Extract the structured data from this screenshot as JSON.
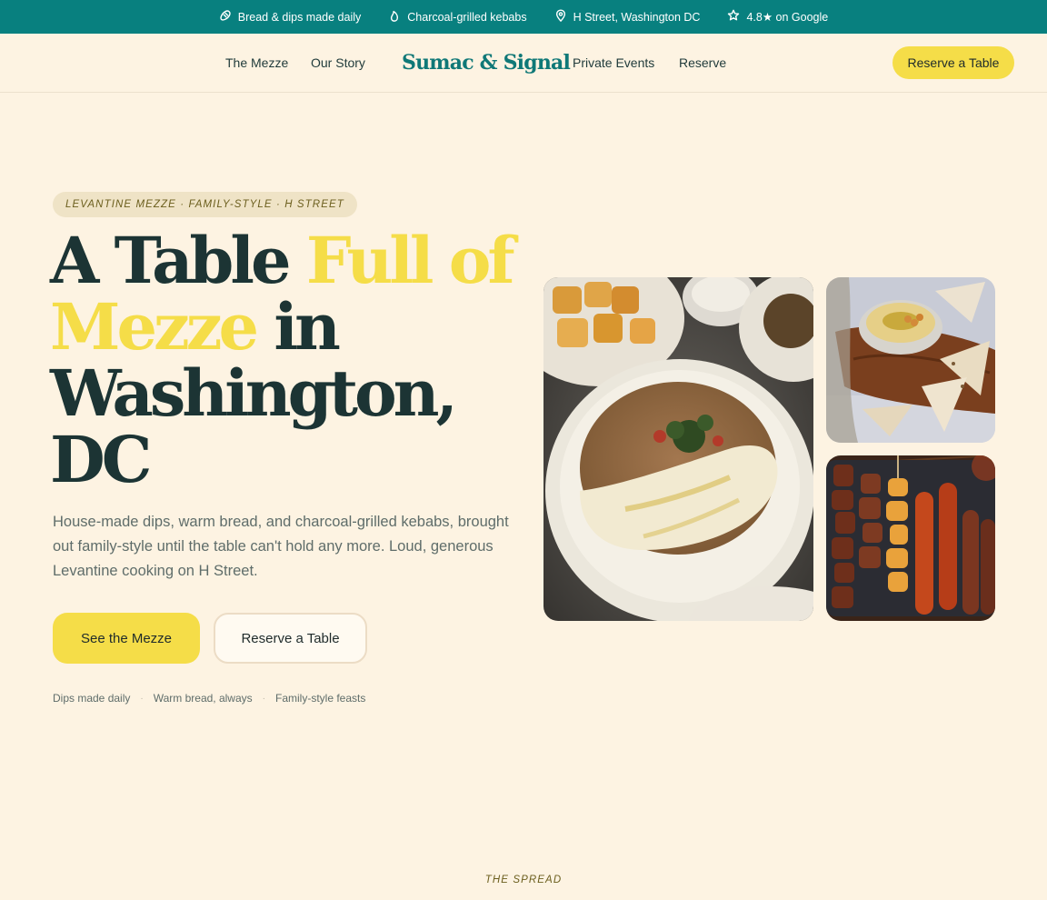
{
  "topbar": {
    "items": [
      {
        "icon": "bread-icon",
        "label": "Bread & dips made daily"
      },
      {
        "icon": "flame-icon",
        "label": "Charcoal-grilled kebabs"
      },
      {
        "icon": "map-pin-icon",
        "label": "H Street, Washington DC"
      },
      {
        "icon": "star-icon",
        "label": "4.8★ on Google"
      }
    ],
    "background": "#08807f"
  },
  "nav": {
    "links": [
      "The Mezze",
      "Our Story",
      "Private Events",
      "Reserve"
    ],
    "brand": "Sumac & Signal",
    "cta": "Reserve a Table"
  },
  "hero": {
    "eyebrow": "LEVANTINE MEZZE · FAMILY-STYLE · H STREET",
    "headline": {
      "part1": "A Table ",
      "highlight1": "Full of",
      "highlight2": "Mezze",
      "part2": " in Washington, DC"
    },
    "lede": "House-made dips, warm bread, and charcoal-grilled kebabs, brought out family-style until the table can't hold any more. Loud, generous Levantine cooking on H Street.",
    "primary_button": "See the Mezze",
    "secondary_button": "Reserve a Table",
    "features": [
      "Dips made daily",
      "Warm bread, always",
      "Family-style feasts"
    ]
  },
  "photos": [
    {
      "name": "ful-medames-bowl-photo"
    },
    {
      "name": "hummus-pita-photo"
    },
    {
      "name": "kebab-skewers-photo"
    }
  ],
  "next_section": {
    "label": "THE SPREAD"
  },
  "colors": {
    "accent_yellow": "#f5dd48",
    "brand_teal": "#0f7877",
    "background": "#fdf3e2",
    "ink": "#1c3434"
  }
}
